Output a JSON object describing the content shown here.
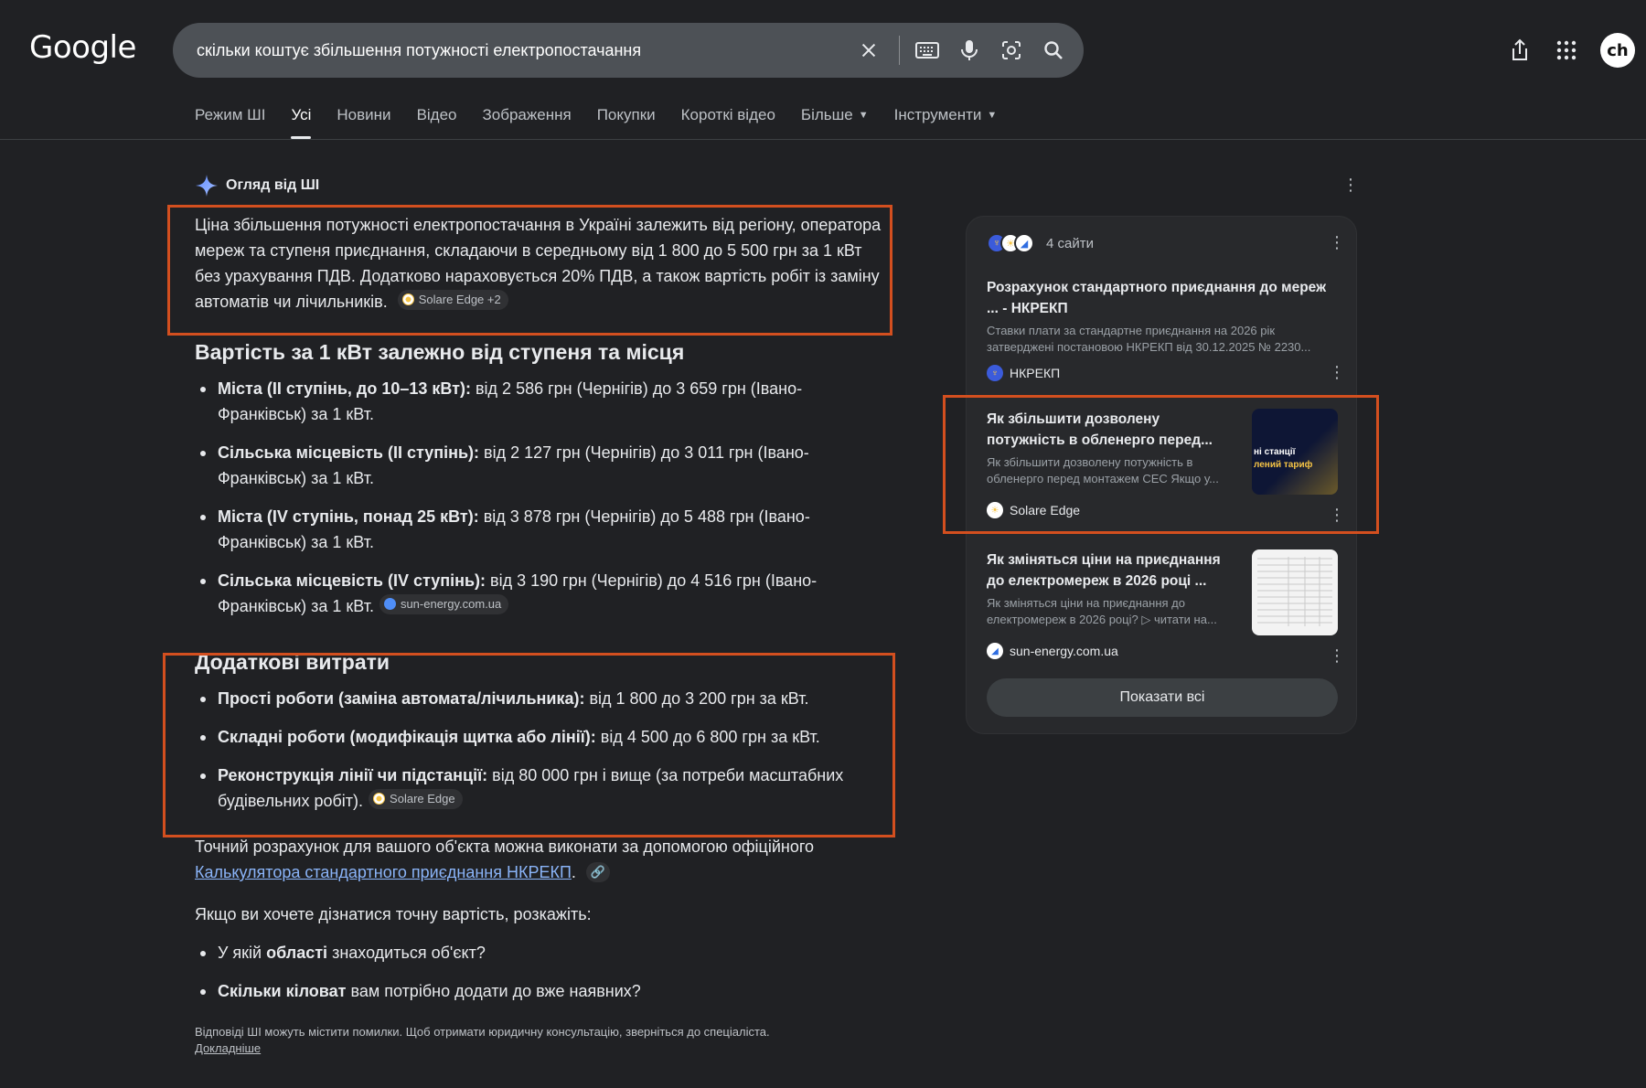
{
  "header": {
    "logo": "Google",
    "search_value": "скільки коштує збільшення потужності електропостачання",
    "avatar_text": "ch"
  },
  "tabs": [
    {
      "label": "Режим ШІ"
    },
    {
      "label": "Усі"
    },
    {
      "label": "Новини"
    },
    {
      "label": "Відео"
    },
    {
      "label": "Зображення"
    },
    {
      "label": "Покупки"
    },
    {
      "label": "Короткі відео"
    },
    {
      "label": "Більше"
    },
    {
      "label": "Інструменти"
    }
  ],
  "ai": {
    "heading": "Огляд від ШІ",
    "intro": "Ціна збільшення потужності електропостачання в Україні залежить від регіону, оператора мереж та ступеня приєднання, складаючи в середньому від 1 800 до 5 500 грн за 1 кВт без урахування ПДВ. Додатково нараховується 20% ПДВ, а також вартість робіт із заміну автоматів чи лічильників.",
    "intro_chip": "Solare Edge +2",
    "section1_title": "Вартість за 1 кВт залежно від ступеня та місця",
    "section1_items": [
      {
        "bold": "Міста (II ступінь, до 10–13 кВт):",
        "text": " від 2 586 грн (Чернігів) до 3 659 грн (Івано-Франківськ) за 1 кВт."
      },
      {
        "bold": "Сільська місцевість (II ступінь):",
        "text": " від 2 127 грн (Чернігів) до 3 011 грн (Івано-Франківськ) за 1 кВт."
      },
      {
        "bold": "Міста (IV ступінь, понад 25 кВт):",
        "text": " від 3 878 грн (Чернігів) до 5 488 грн (Івано-Франківськ) за 1 кВт."
      },
      {
        "bold": "Сільська місцевість (IV ступінь):",
        "text": " від 3 190 грн (Чернігів) до 4 516 грн (Івано-Франківськ) за 1 кВт."
      }
    ],
    "section1_chip": "sun-energy.com.ua",
    "section2_title": "Додаткові витрати",
    "section2_items": [
      {
        "bold": "Прості роботи (заміна автомата/лічильника):",
        "text": " від 1 800 до 3 200 грн за кВт."
      },
      {
        "bold": "Складні роботи (модифікація щитка або лінії):",
        "text": " від 4 500 до 6 800 грн за кВт."
      },
      {
        "bold": "Реконструкція лінії чи підстанції:",
        "text": " від 80 000 грн і вище (за потреби масштабних будівельних робіт)."
      }
    ],
    "section2_chip": "Solare Edge",
    "calc_text": "Точний розрахунок для вашого об'єкта можна виконати за допомогою офіційного",
    "calc_link": "Калькулятора стандартного приєднання НКРЕКП",
    "ask_text": "Якщо ви хочете дізнатися точну вартість, розкажіть:",
    "ask_items": [
      {
        "pre": "У якій ",
        "bold": "області",
        "post": " знаходиться об'єкт?"
      },
      {
        "pre": "",
        "bold": "Скільки кіловат",
        "post": " вам потрібно додати до вже наявних?"
      }
    ],
    "disclaimer": "Відповіді ШІ можуть містити помилки. Щоб отримати юридичну консультацію, зверніться до спеціаліста.",
    "disclaimer_more": "Докладніше"
  },
  "panel": {
    "sites_count": "4 сайти",
    "sources": [
      {
        "title": "Розрахунок стандартного приєднання до мереж ... - НКРЕКП",
        "desc": "Ставки плати за стандартне приєднання на 2026 рік затверджені постановою НКРЕКП від 30.12.2025 № 2230...",
        "site": "НКРЕКП"
      },
      {
        "title": "Як збільшити дозволену потужність в обленерго перед...",
        "desc": "Як збільшити дозволену потужність в обленерго перед монтажем СЕС Якщо у...",
        "site": "Solare Edge",
        "thumb_line1": "ні станції",
        "thumb_line2": "лений тариф"
      },
      {
        "title": "Як зміняться ціни на приєднання до електромереж в 2026 році ...",
        "desc": "Як зміняться ціни на приєднання до електромереж в 2026 році? ▷ читати на...",
        "site": "sun-energy.com.ua"
      }
    ],
    "show_all": "Показати всі"
  }
}
